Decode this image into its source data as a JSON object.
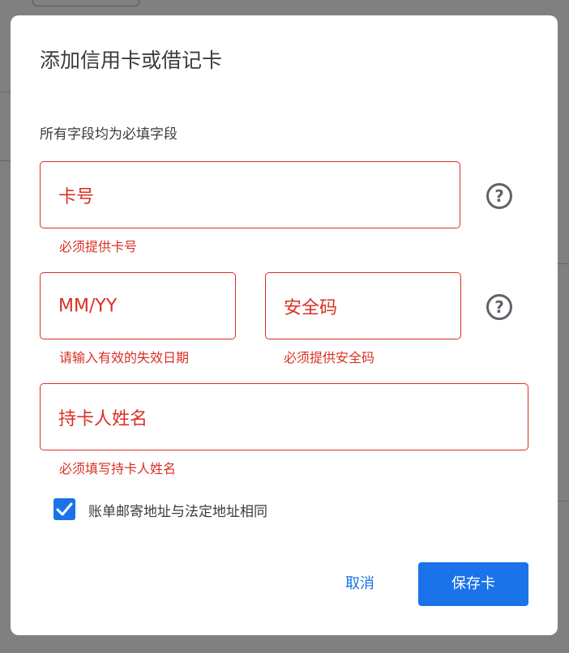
{
  "dialog": {
    "title": "添加信用卡或借记卡",
    "required_note": "所有字段均为必填字段"
  },
  "fields": {
    "card_number": {
      "placeholder": "卡号",
      "error": "必须提供卡号"
    },
    "expiry": {
      "placeholder": "MM/YY",
      "error": "请输入有效的失效日期"
    },
    "security_code": {
      "placeholder": "安全码",
      "error": "必须提供安全码"
    },
    "cardholder_name": {
      "placeholder": "持卡人姓名",
      "error": "必须填写持卡人姓名"
    }
  },
  "help_icon_glyph": "?",
  "billing_checkbox": {
    "label": "账单邮寄地址与法定地址相同",
    "checked": true
  },
  "buttons": {
    "cancel": "取消",
    "save": "保存卡"
  },
  "colors": {
    "accent": "#1a73e8",
    "error": "#d93025",
    "text": "#3c3c3c",
    "icon": "#5f6368"
  }
}
